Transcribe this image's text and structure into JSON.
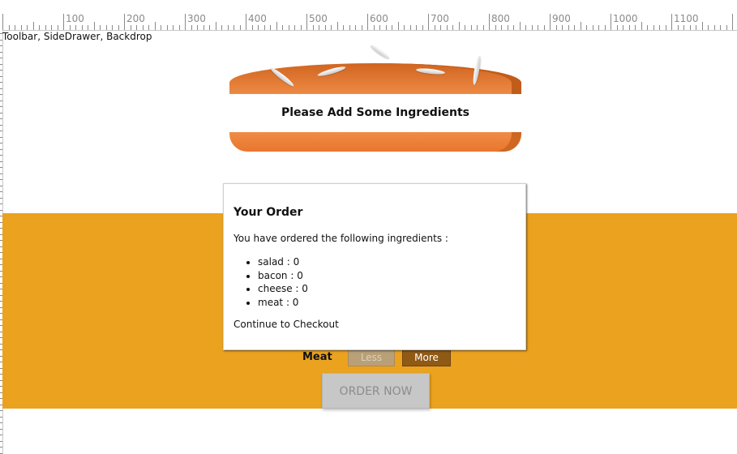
{
  "ruler": {
    "labels": [
      "100",
      "200",
      "300",
      "400",
      "500",
      "600",
      "700",
      "800",
      "900",
      "1000",
      "1100"
    ]
  },
  "toolbar_text": "Toolbar, SideDrawer, Backdrop",
  "burger": {
    "message": "Please Add Some Ingredients"
  },
  "controls": {
    "visible_control": {
      "label": "Meat",
      "less": "Less",
      "more": "More"
    },
    "order_button": "ORDER NOW"
  },
  "modal": {
    "title": "Your Order",
    "intro": "You have ordered the following ingredients :",
    "items": [
      "salad : 0",
      "bacon : 0",
      "cheese : 0",
      "meat : 0"
    ],
    "continue": "Continue to Checkout"
  },
  "colors": {
    "controls_background": "#eba21e",
    "bun": "#e8762e",
    "more_button": "#8f5a16",
    "less_button_disabled": "#b9a078",
    "order_button_disabled": "#c7c7c7"
  }
}
